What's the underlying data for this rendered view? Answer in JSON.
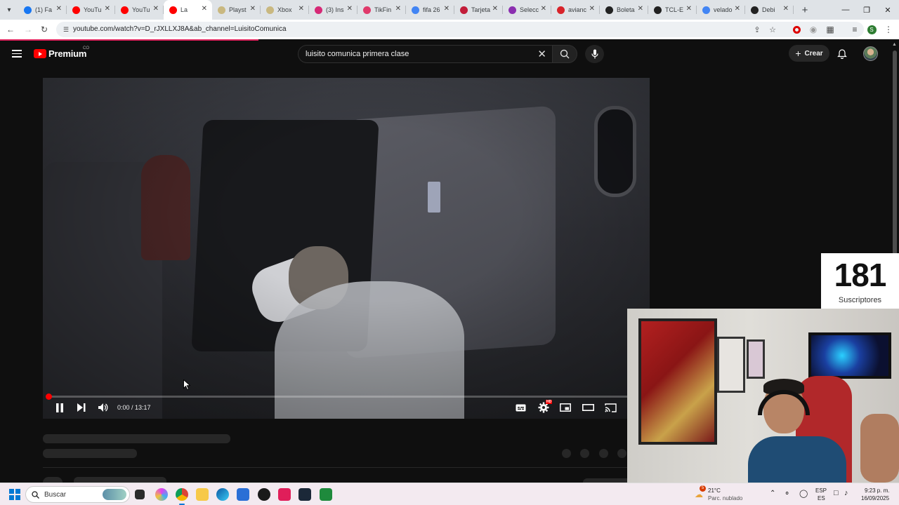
{
  "browser": {
    "tabs": [
      {
        "label": "(1) Fa",
        "color": "#1877f2",
        "active": false
      },
      {
        "label": "YouTu",
        "color": "#ff0000",
        "active": false
      },
      {
        "label": "YouTu",
        "color": "#ff0000",
        "active": false
      },
      {
        "label": "La",
        "color": "#ff0000",
        "active": true
      },
      {
        "label": "Playst",
        "color": "#c9b880",
        "active": false
      },
      {
        "label": "Xbox",
        "color": "#c9b880",
        "active": false
      },
      {
        "label": "(3) Ins",
        "color": "#d62976",
        "active": false
      },
      {
        "label": "TikFin",
        "color": "#e03a6b",
        "active": false
      },
      {
        "label": "fifa 26",
        "color": "#4285f4",
        "active": false
      },
      {
        "label": "Tarjeta",
        "color": "#c21d3a",
        "active": false
      },
      {
        "label": "Selecc",
        "color": "#8b2fb0",
        "active": false
      },
      {
        "label": "avianc",
        "color": "#d8232a",
        "active": false
      },
      {
        "label": "Boleta",
        "color": "#222222",
        "active": false
      },
      {
        "label": "TCL-E",
        "color": "#222222",
        "active": false
      },
      {
        "label": "velado",
        "color": "#4285f4",
        "active": false
      },
      {
        "label": "Debi",
        "color": "#222222",
        "active": false
      }
    ],
    "url": "youtube.com/watch?v=D_rJXLLXJ8A&ab_channel=LuisitoComunica",
    "loading_progress": 0.29
  },
  "youtube": {
    "logo_text": "Premium",
    "country_code": "CO",
    "search_query": "luisito comunica primera clase",
    "create_label": "Crear"
  },
  "player": {
    "current_time": "0:00",
    "duration": "13:17",
    "time_display": "0:00 / 13:17",
    "progress": 0.0,
    "settings_badge": "HD"
  },
  "overlay": {
    "subscriber_count": "181",
    "subscriber_label": "Suscriptores"
  },
  "taskbar": {
    "search_placeholder": "Buscar",
    "weather_temp": "21°C",
    "weather_desc": "Parc. nublado",
    "weather_badge": "5",
    "lang_primary": "ESP",
    "lang_secondary": "ES",
    "clock_time": "9:23 p. m.",
    "clock_date": "16/09/2025"
  },
  "colors": {
    "youtube_red": "#ff0000",
    "background": "#0f0f0f",
    "accent_blue": "#0078d4"
  }
}
